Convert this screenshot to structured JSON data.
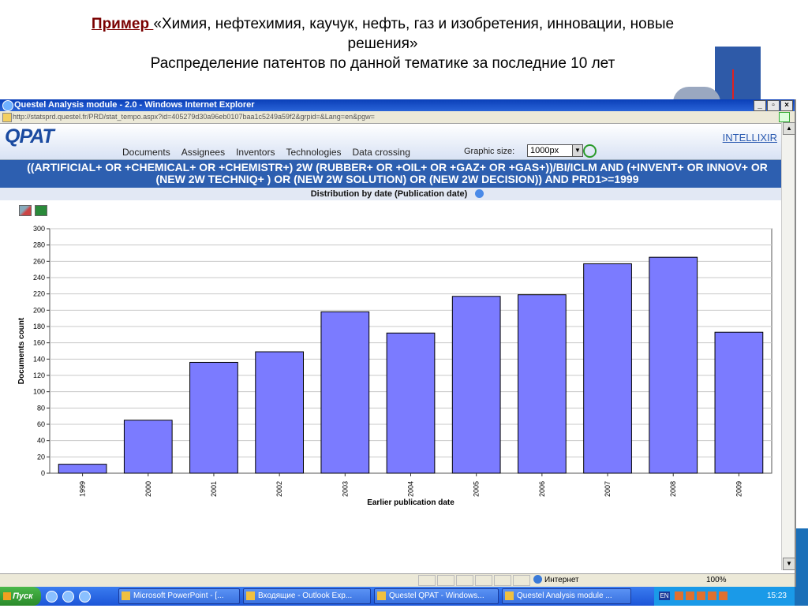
{
  "slide": {
    "keyword": "Пример ",
    "title_line1": "«Химия, нефтехимия,  каучук, нефть, газ и  изобретения, инновации, новые",
    "title_line2": "решения»",
    "title_line3": "Распределение патентов по  данной тематике     за последние 10 лет"
  },
  "browser": {
    "title": "Questel Analysis module - 2.0 - Windows Internet Explorer",
    "url": "http://statsprd.questel.fr/PRD/stat_tempo.aspx?id=405279d30a96eb0107baa1c5249a59f2&grpid=&Lang=en&pgw="
  },
  "app": {
    "logo": "QPAT",
    "brand": "INTELLIXIR",
    "nav": [
      "Documents",
      "Assignees",
      "Inventors",
      "Technologies",
      "Data crossing"
    ],
    "graphic_size_label": "Graphic size:",
    "graphic_size_value": "1000px",
    "query": "((ARTIFICIAL+ OR +CHEMICAL+ OR +CHEMISTR+) 2W (RUBBER+ OR +OIL+ OR +GAZ+ OR +GAS+))/BI/ICLM AND (+INVENT+ OR INNOV+ OR (NEW 2W TECHNIQ+ ) OR (NEW 2W SOLUTION) OR (NEW 2W DECISION)) AND PRD1>=1999",
    "subtitle": "Distribution by date (Publication date)"
  },
  "chart_data": {
    "type": "bar",
    "categories": [
      "1999",
      "2000",
      "2001",
      "2002",
      "2003",
      "2004",
      "2005",
      "2006",
      "2007",
      "2008",
      "2009"
    ],
    "values": [
      11,
      65,
      136,
      149,
      198,
      172,
      217,
      219,
      257,
      265,
      173
    ],
    "xlabel": "Earlier publication date",
    "ylabel": "Documents count",
    "ylim": [
      0,
      300
    ],
    "yticks": [
      0,
      20,
      40,
      60,
      80,
      100,
      120,
      140,
      160,
      180,
      200,
      220,
      240,
      260,
      280,
      300
    ],
    "bar_color": "#7b7bff",
    "grid": true
  },
  "status": {
    "zone": "Интернет",
    "zoom": "100%"
  },
  "taskbar": {
    "start": "Пуск",
    "tasks": [
      "Microsoft PowerPoint - [...",
      "Входящие - Outlook Exp...",
      "Questel QPAT - Windows...",
      "Questel Analysis module ..."
    ],
    "lang": "EN",
    "clock": "15:23"
  },
  "colors": {
    "query_bar": "#2d5fb0",
    "titlebar": "#0a3fb8"
  }
}
